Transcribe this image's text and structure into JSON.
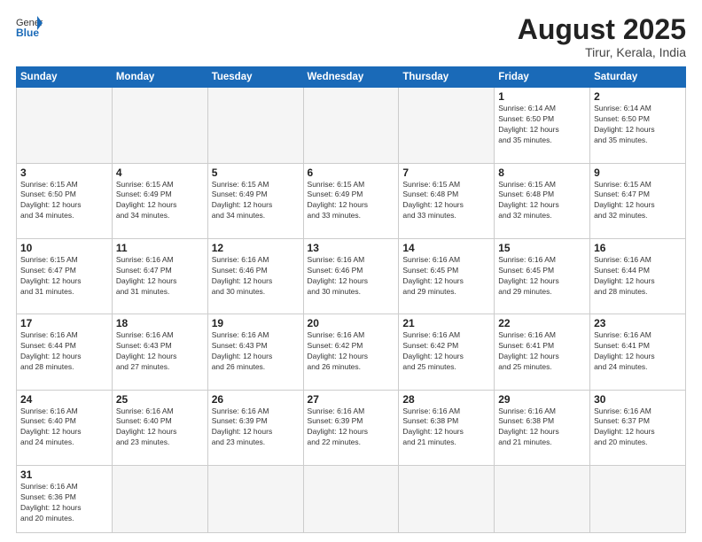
{
  "logo": {
    "general": "General",
    "blue": "Blue"
  },
  "header": {
    "title": "August 2025",
    "subtitle": "Tirur, Kerala, India"
  },
  "weekdays": [
    "Sunday",
    "Monday",
    "Tuesday",
    "Wednesday",
    "Thursday",
    "Friday",
    "Saturday"
  ],
  "weeks": [
    [
      {
        "day": "",
        "info": ""
      },
      {
        "day": "",
        "info": ""
      },
      {
        "day": "",
        "info": ""
      },
      {
        "day": "",
        "info": ""
      },
      {
        "day": "",
        "info": ""
      },
      {
        "day": "1",
        "info": "Sunrise: 6:14 AM\nSunset: 6:50 PM\nDaylight: 12 hours\nand 35 minutes."
      },
      {
        "day": "2",
        "info": "Sunrise: 6:14 AM\nSunset: 6:50 PM\nDaylight: 12 hours\nand 35 minutes."
      }
    ],
    [
      {
        "day": "3",
        "info": "Sunrise: 6:15 AM\nSunset: 6:50 PM\nDaylight: 12 hours\nand 34 minutes."
      },
      {
        "day": "4",
        "info": "Sunrise: 6:15 AM\nSunset: 6:49 PM\nDaylight: 12 hours\nand 34 minutes."
      },
      {
        "day": "5",
        "info": "Sunrise: 6:15 AM\nSunset: 6:49 PM\nDaylight: 12 hours\nand 34 minutes."
      },
      {
        "day": "6",
        "info": "Sunrise: 6:15 AM\nSunset: 6:49 PM\nDaylight: 12 hours\nand 33 minutes."
      },
      {
        "day": "7",
        "info": "Sunrise: 6:15 AM\nSunset: 6:48 PM\nDaylight: 12 hours\nand 33 minutes."
      },
      {
        "day": "8",
        "info": "Sunrise: 6:15 AM\nSunset: 6:48 PM\nDaylight: 12 hours\nand 32 minutes."
      },
      {
        "day": "9",
        "info": "Sunrise: 6:15 AM\nSunset: 6:47 PM\nDaylight: 12 hours\nand 32 minutes."
      }
    ],
    [
      {
        "day": "10",
        "info": "Sunrise: 6:15 AM\nSunset: 6:47 PM\nDaylight: 12 hours\nand 31 minutes."
      },
      {
        "day": "11",
        "info": "Sunrise: 6:16 AM\nSunset: 6:47 PM\nDaylight: 12 hours\nand 31 minutes."
      },
      {
        "day": "12",
        "info": "Sunrise: 6:16 AM\nSunset: 6:46 PM\nDaylight: 12 hours\nand 30 minutes."
      },
      {
        "day": "13",
        "info": "Sunrise: 6:16 AM\nSunset: 6:46 PM\nDaylight: 12 hours\nand 30 minutes."
      },
      {
        "day": "14",
        "info": "Sunrise: 6:16 AM\nSunset: 6:45 PM\nDaylight: 12 hours\nand 29 minutes."
      },
      {
        "day": "15",
        "info": "Sunrise: 6:16 AM\nSunset: 6:45 PM\nDaylight: 12 hours\nand 29 minutes."
      },
      {
        "day": "16",
        "info": "Sunrise: 6:16 AM\nSunset: 6:44 PM\nDaylight: 12 hours\nand 28 minutes."
      }
    ],
    [
      {
        "day": "17",
        "info": "Sunrise: 6:16 AM\nSunset: 6:44 PM\nDaylight: 12 hours\nand 28 minutes."
      },
      {
        "day": "18",
        "info": "Sunrise: 6:16 AM\nSunset: 6:43 PM\nDaylight: 12 hours\nand 27 minutes."
      },
      {
        "day": "19",
        "info": "Sunrise: 6:16 AM\nSunset: 6:43 PM\nDaylight: 12 hours\nand 26 minutes."
      },
      {
        "day": "20",
        "info": "Sunrise: 6:16 AM\nSunset: 6:42 PM\nDaylight: 12 hours\nand 26 minutes."
      },
      {
        "day": "21",
        "info": "Sunrise: 6:16 AM\nSunset: 6:42 PM\nDaylight: 12 hours\nand 25 minutes."
      },
      {
        "day": "22",
        "info": "Sunrise: 6:16 AM\nSunset: 6:41 PM\nDaylight: 12 hours\nand 25 minutes."
      },
      {
        "day": "23",
        "info": "Sunrise: 6:16 AM\nSunset: 6:41 PM\nDaylight: 12 hours\nand 24 minutes."
      }
    ],
    [
      {
        "day": "24",
        "info": "Sunrise: 6:16 AM\nSunset: 6:40 PM\nDaylight: 12 hours\nand 24 minutes."
      },
      {
        "day": "25",
        "info": "Sunrise: 6:16 AM\nSunset: 6:40 PM\nDaylight: 12 hours\nand 23 minutes."
      },
      {
        "day": "26",
        "info": "Sunrise: 6:16 AM\nSunset: 6:39 PM\nDaylight: 12 hours\nand 23 minutes."
      },
      {
        "day": "27",
        "info": "Sunrise: 6:16 AM\nSunset: 6:39 PM\nDaylight: 12 hours\nand 22 minutes."
      },
      {
        "day": "28",
        "info": "Sunrise: 6:16 AM\nSunset: 6:38 PM\nDaylight: 12 hours\nand 21 minutes."
      },
      {
        "day": "29",
        "info": "Sunrise: 6:16 AM\nSunset: 6:38 PM\nDaylight: 12 hours\nand 21 minutes."
      },
      {
        "day": "30",
        "info": "Sunrise: 6:16 AM\nSunset: 6:37 PM\nDaylight: 12 hours\nand 20 minutes."
      }
    ],
    [
      {
        "day": "31",
        "info": "Sunrise: 6:16 AM\nSunset: 6:36 PM\nDaylight: 12 hours\nand 20 minutes."
      },
      {
        "day": "",
        "info": ""
      },
      {
        "day": "",
        "info": ""
      },
      {
        "day": "",
        "info": ""
      },
      {
        "day": "",
        "info": ""
      },
      {
        "day": "",
        "info": ""
      },
      {
        "day": "",
        "info": ""
      }
    ]
  ]
}
